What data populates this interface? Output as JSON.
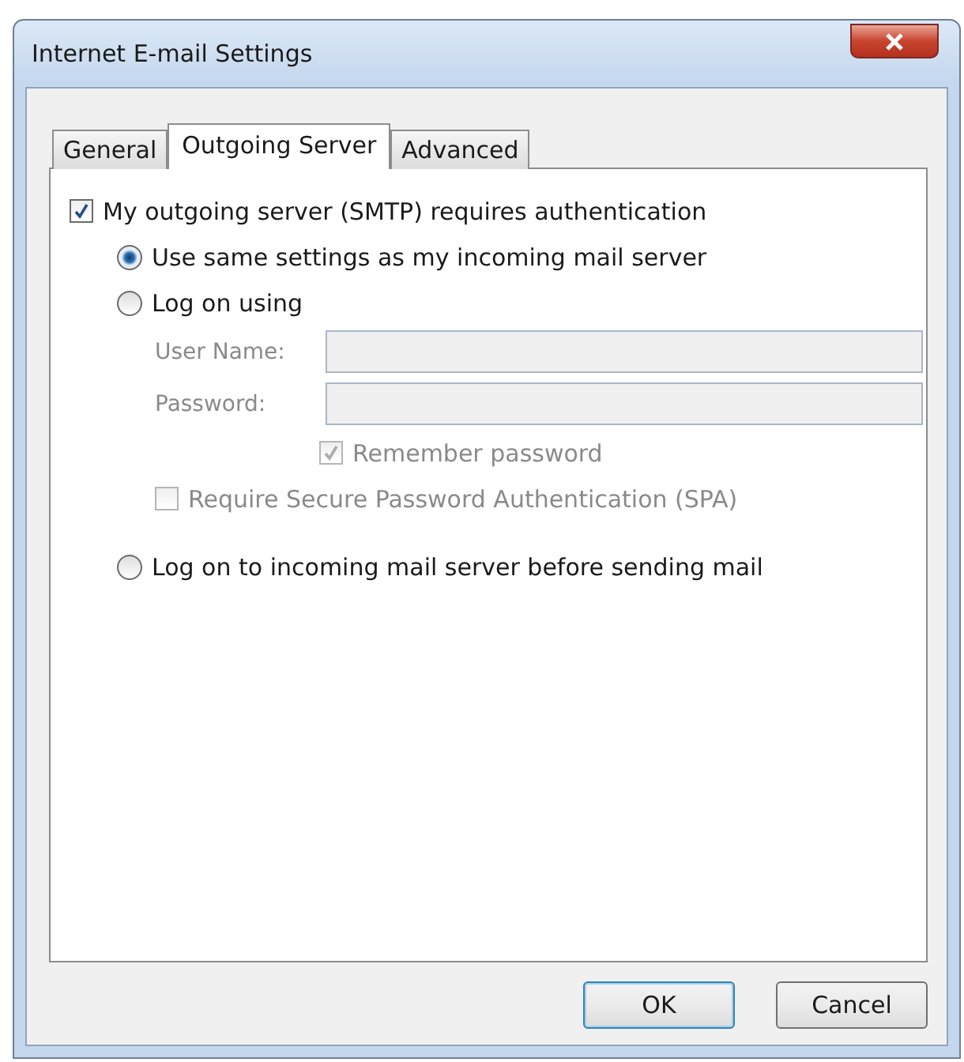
{
  "window": {
    "title": "Internet E-mail Settings"
  },
  "tabs": [
    {
      "label": "General",
      "selected": false
    },
    {
      "label": "Outgoing Server",
      "selected": true
    },
    {
      "label": "Advanced",
      "selected": false
    }
  ],
  "items": [
    {
      "kind": "checkbox",
      "label": "My outgoing server (SMTP) requires authentication",
      "checked": true,
      "disabled": false,
      "children": [
        {
          "kind": "radio",
          "label": "Use same settings as my incoming mail server",
          "selected": true,
          "disabled": false
        },
        {
          "kind": "radio",
          "label": "Log on using",
          "selected": false,
          "disabled": false,
          "children": [
            {
              "kind": "field",
              "label": "User Name:",
              "disabled": true
            },
            {
              "kind": "field",
              "label": "Password:",
              "disabled": true
            },
            {
              "kind": "field_checkbox",
              "label": "Remember password",
              "checked": true,
              "disabled": true
            },
            {
              "kind": "checkbox",
              "label": "Require Secure Password Authentication (SPA)",
              "checked": false,
              "disabled": true
            }
          ]
        },
        {
          "kind": "radio",
          "label": "Log on to incoming mail server before sending mail",
          "selected": false,
          "disabled": false
        }
      ]
    }
  ],
  "buttons": [
    {
      "label": "OK",
      "default": true
    },
    {
      "label": "Cancel",
      "default": false
    }
  ]
}
